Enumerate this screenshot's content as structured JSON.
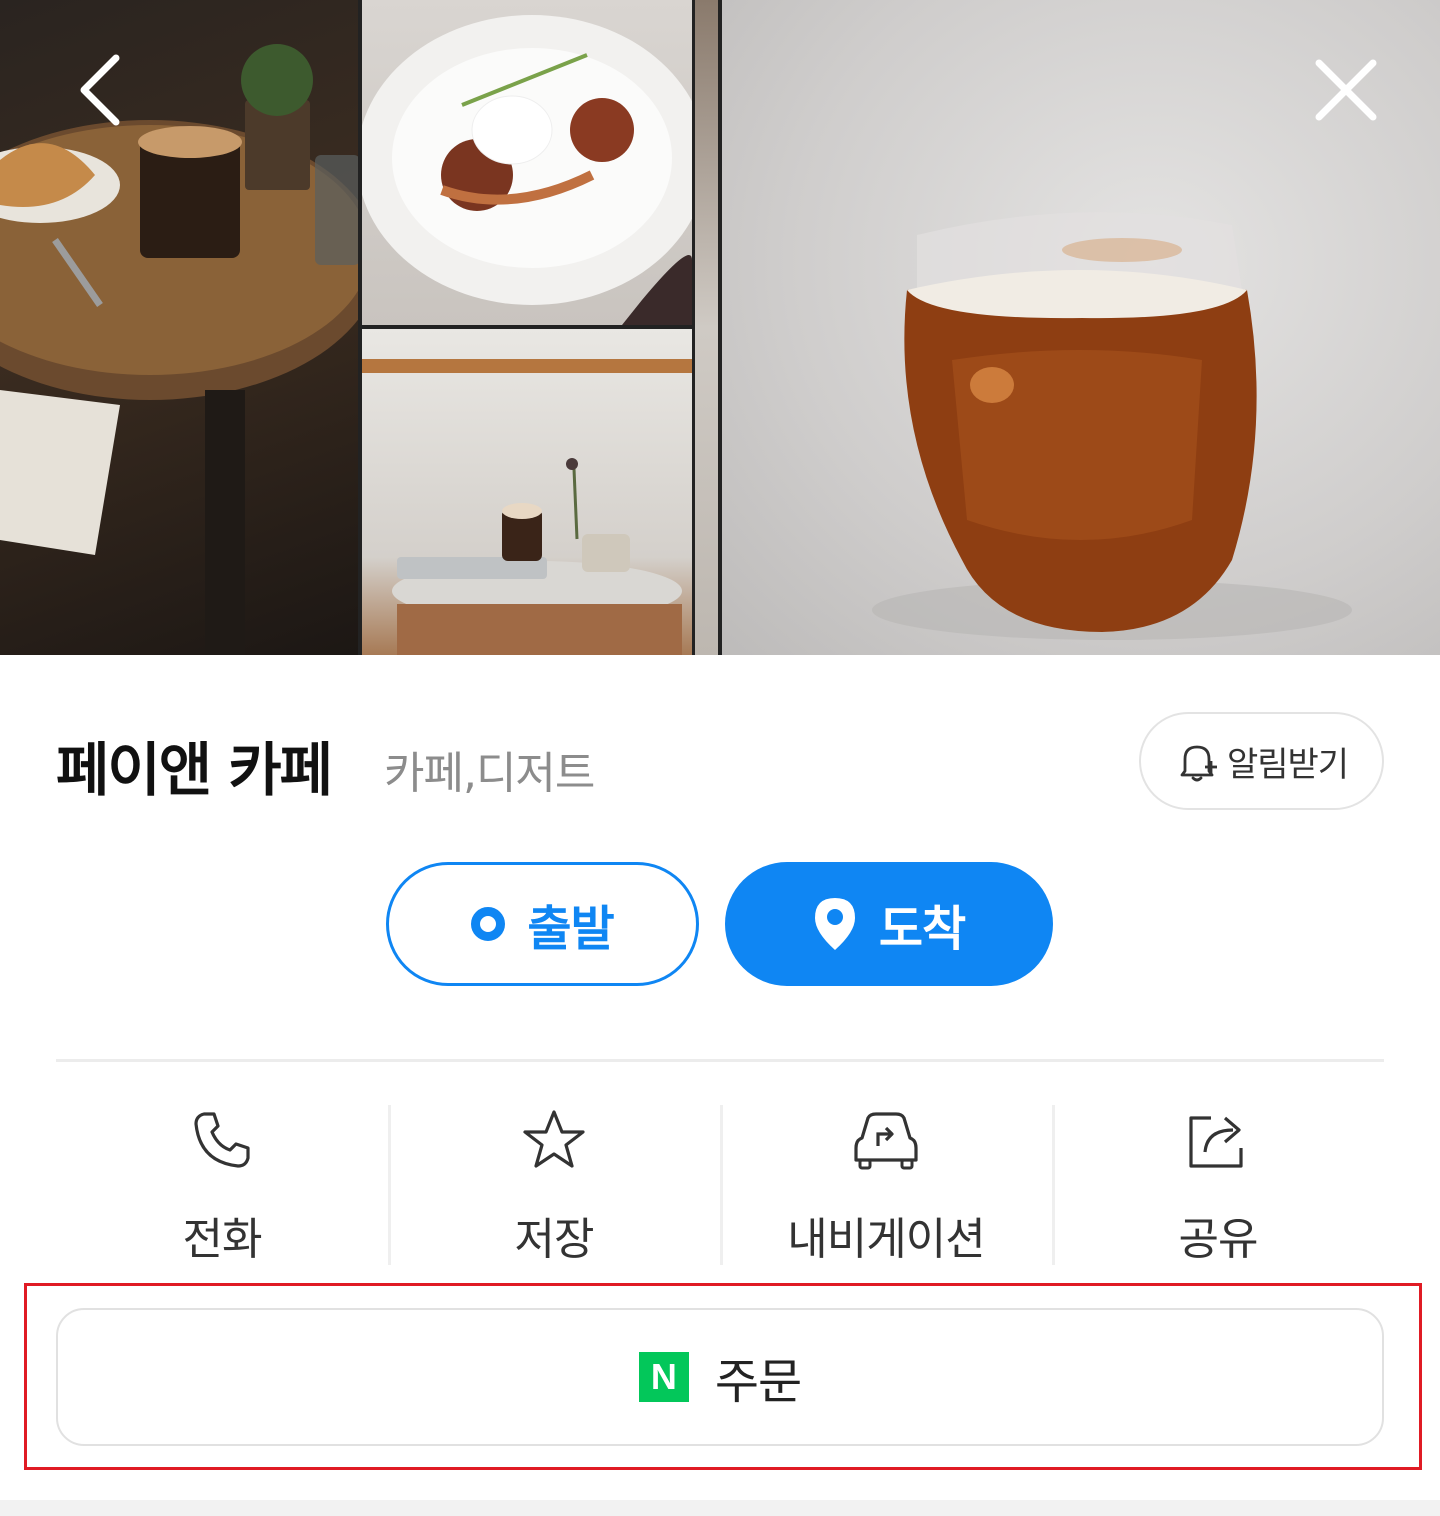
{
  "gallery": {
    "photos": [
      {
        "name": "photo-coffee-table"
      },
      {
        "name": "photo-dessert-plate"
      },
      {
        "name": "photo-cafe-interior"
      },
      {
        "name": "photo-strip"
      },
      {
        "name": "photo-iced-coffee"
      }
    ],
    "back_icon": "chevron-left-icon",
    "close_icon": "close-icon"
  },
  "place": {
    "name": "페이앤 카페",
    "category": "카페,디저트",
    "alert_label": "알림받기",
    "alert_icon": "bell-plus-icon"
  },
  "route": {
    "depart_label": "출발",
    "arrive_label": "도착",
    "depart_icon": "origin-dot-icon",
    "arrive_icon": "location-pin-icon"
  },
  "actions": [
    {
      "label": "전화",
      "icon": "phone-icon"
    },
    {
      "label": "저장",
      "icon": "star-icon"
    },
    {
      "label": "내비게이션",
      "icon": "car-navigation-icon"
    },
    {
      "label": "공유",
      "icon": "share-icon"
    }
  ],
  "order": {
    "logo_text": "N",
    "label": "주문",
    "logo_color": "#03c75a"
  },
  "colors": {
    "accent": "#0f86f3",
    "highlight_border": "#e01b24"
  }
}
